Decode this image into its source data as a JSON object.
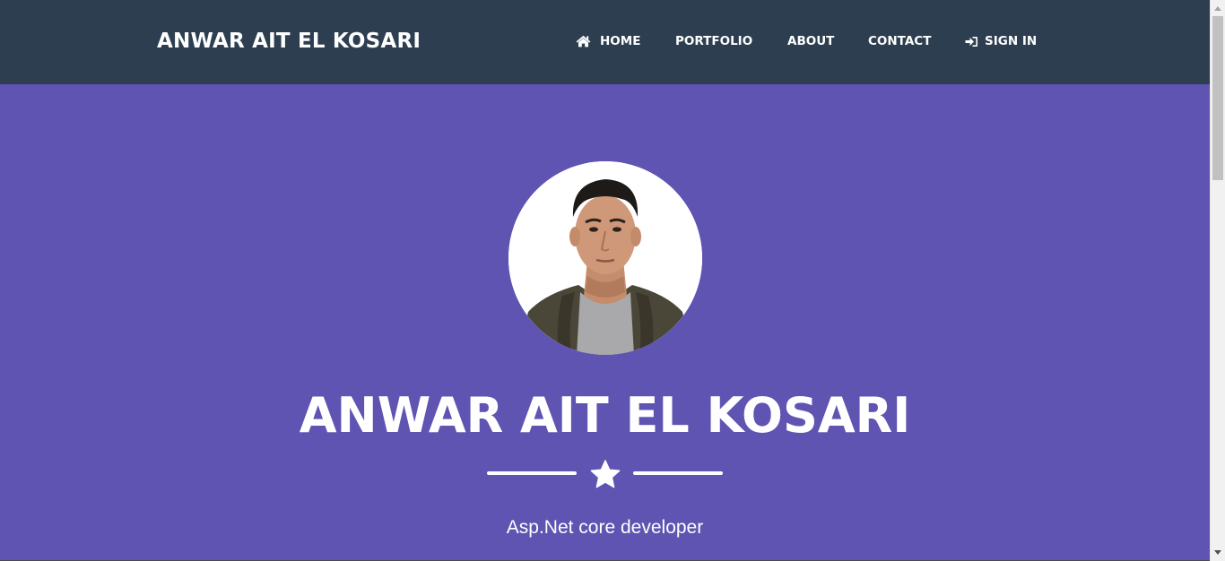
{
  "navbar": {
    "brand": "ANWAR AIT EL KOSARI",
    "items": [
      {
        "label": "HOME",
        "icon": "home-icon"
      },
      {
        "label": "PORTFOLIO"
      },
      {
        "label": "ABOUT"
      },
      {
        "label": "CONTACT"
      },
      {
        "label": "SIGN IN",
        "icon": "sign-in-icon"
      }
    ]
  },
  "hero": {
    "title": "ANWAR AIT EL KOSARI",
    "divider_icon": "star-icon",
    "subtitle": "Asp.Net core developer"
  },
  "colors": {
    "navbar_bg": "#2c3e50",
    "hero_bg": "#5f54b2",
    "text": "#ffffff"
  }
}
